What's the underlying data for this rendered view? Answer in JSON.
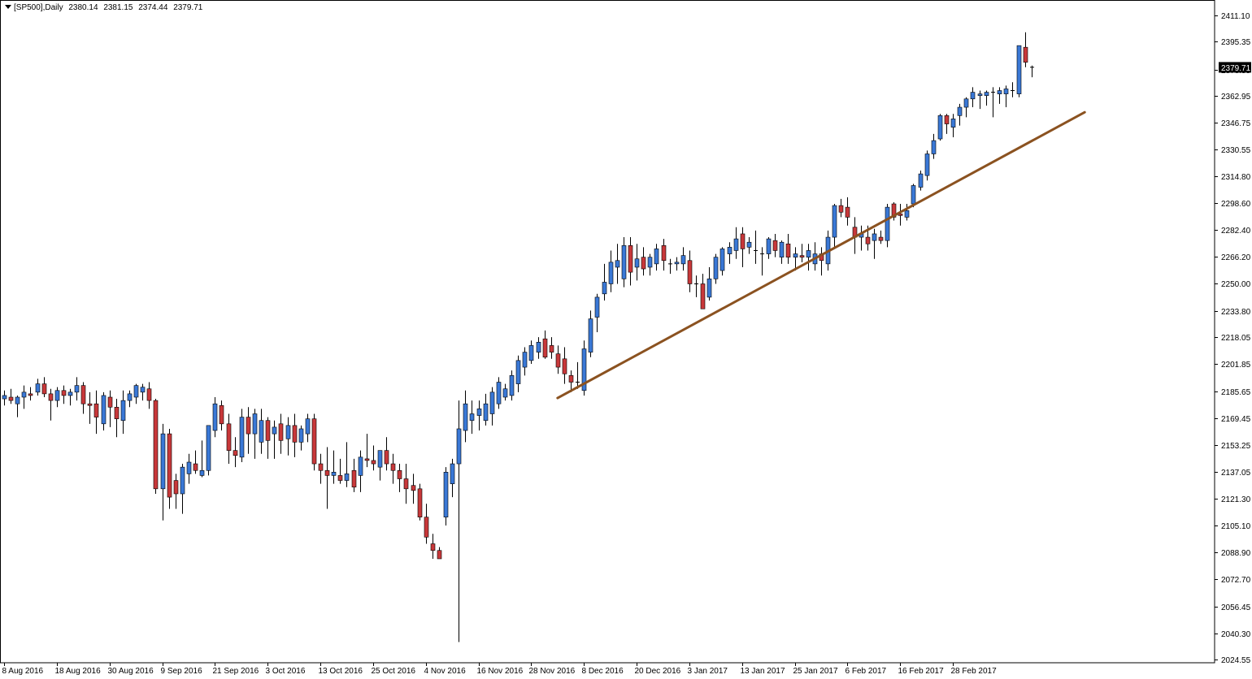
{
  "header": {
    "symbol": "[SP500],Daily",
    "open": "2380.14",
    "high": "2381.15",
    "low": "2374.44",
    "close": "2379.71"
  },
  "colors": {
    "bull": "#3a78d6",
    "bear": "#c8383a",
    "wick": "#000000",
    "trendline": "#8b5220",
    "axis": "#000000",
    "background": "#ffffff",
    "price_label_bg": "#000000",
    "price_label_fg": "#ffffff"
  },
  "chart_data": {
    "type": "candlestick",
    "ylim": [
      2024.55,
      2411.1
    ],
    "y_ticks": [
      "2411.10",
      "2395.35",
      "2378.55",
      "2362.95",
      "2346.75",
      "2330.55",
      "2314.80",
      "2298.60",
      "2282.40",
      "2266.20",
      "2250.00",
      "2233.80",
      "2218.05",
      "2201.85",
      "2185.65",
      "2169.45",
      "2153.25",
      "2137.05",
      "2121.30",
      "2105.10",
      "2088.90",
      "2072.70",
      "2056.45",
      "2040.30",
      "2024.55"
    ],
    "x_labels": [
      {
        "i": 0,
        "label": "8 Aug 2016"
      },
      {
        "i": 8,
        "label": "18 Aug 2016"
      },
      {
        "i": 16,
        "label": "30 Aug 2016"
      },
      {
        "i": 24,
        "label": "9 Sep 2016"
      },
      {
        "i": 32,
        "label": "21 Sep 2016"
      },
      {
        "i": 40,
        "label": "3 Oct 2016"
      },
      {
        "i": 48,
        "label": "13 Oct 2016"
      },
      {
        "i": 56,
        "label": "25 Oct 2016"
      },
      {
        "i": 64,
        "label": "4 Nov 2016"
      },
      {
        "i": 72,
        "label": "16 Nov 2016"
      },
      {
        "i": 80,
        "label": "28 Nov 2016"
      },
      {
        "i": 88,
        "label": "8 Dec 2016"
      },
      {
        "i": 96,
        "label": "20 Dec 2016"
      },
      {
        "i": 104,
        "label": "3 Jan 2017"
      },
      {
        "i": 112,
        "label": "13 Jan 2017"
      },
      {
        "i": 120,
        "label": "25 Jan 2017"
      },
      {
        "i": 128,
        "label": "6 Feb 2017"
      },
      {
        "i": 136,
        "label": "16 Feb 2017"
      },
      {
        "i": 144,
        "label": "28 Feb 2017"
      }
    ],
    "current_price_label": "2379.71",
    "current_price": 2379.71,
    "trendline": {
      "from": {
        "i": 84,
        "price": 2181.5
      },
      "to": {
        "i": 164,
        "price": 2353.0
      }
    },
    "candles": [
      [
        2181,
        2186,
        2177,
        2183
      ],
      [
        2182,
        2187,
        2178,
        2180
      ],
      [
        2178,
        2183,
        2170,
        2182
      ],
      [
        2182,
        2189,
        2175,
        2185
      ],
      [
        2184,
        2188,
        2180,
        2183
      ],
      [
        2185,
        2193,
        2183,
        2190
      ],
      [
        2190,
        2194,
        2182,
        2184
      ],
      [
        2184,
        2187,
        2168,
        2180
      ],
      [
        2180,
        2188,
        2176,
        2186
      ],
      [
        2186,
        2189,
        2178,
        2183
      ],
      [
        2183,
        2187,
        2177,
        2185
      ],
      [
        2185,
        2194,
        2180,
        2189
      ],
      [
        2189,
        2191,
        2172,
        2178
      ],
      [
        2178,
        2185,
        2166,
        2177
      ],
      [
        2178,
        2186,
        2160,
        2170
      ],
      [
        2166,
        2185,
        2162,
        2183
      ],
      [
        2182,
        2186,
        2164,
        2176
      ],
      [
        2176,
        2181,
        2158,
        2169
      ],
      [
        2168,
        2186,
        2160,
        2180
      ],
      [
        2180,
        2186,
        2176,
        2184
      ],
      [
        2182,
        2190,
        2178,
        2189
      ],
      [
        2185,
        2190,
        2180,
        2188
      ],
      [
        2187,
        2191,
        2175,
        2180
      ],
      [
        2180,
        2181,
        2124,
        2127
      ],
      [
        2127,
        2166,
        2108,
        2160
      ],
      [
        2160,
        2163,
        2115,
        2122
      ],
      [
        2132,
        2136,
        2115,
        2124
      ],
      [
        2124,
        2142,
        2112,
        2140
      ],
      [
        2136,
        2148,
        2130,
        2143
      ],
      [
        2142,
        2150,
        2136,
        2138
      ],
      [
        2135,
        2156,
        2134,
        2138
      ],
      [
        2138,
        2165,
        2135,
        2165
      ],
      [
        2162,
        2182,
        2158,
        2178
      ],
      [
        2177,
        2180,
        2162,
        2166
      ],
      [
        2166,
        2172,
        2142,
        2150
      ],
      [
        2150,
        2158,
        2140,
        2147
      ],
      [
        2146,
        2175,
        2143,
        2170
      ],
      [
        2170,
        2176,
        2148,
        2160
      ],
      [
        2160,
        2175,
        2145,
        2172
      ],
      [
        2155,
        2175,
        2148,
        2168
      ],
      [
        2168,
        2170,
        2145,
        2156
      ],
      [
        2160,
        2168,
        2145,
        2164
      ],
      [
        2166,
        2172,
        2148,
        2156
      ],
      [
        2157,
        2170,
        2147,
        2165
      ],
      [
        2165,
        2172,
        2146,
        2155
      ],
      [
        2155,
        2165,
        2150,
        2163
      ],
      [
        2160,
        2172,
        2155,
        2169
      ],
      [
        2169,
        2172,
        2138,
        2142
      ],
      [
        2142,
        2148,
        2130,
        2138
      ],
      [
        2138,
        2152,
        2115,
        2135
      ],
      [
        2135,
        2150,
        2130,
        2137
      ],
      [
        2135,
        2145,
        2130,
        2132
      ],
      [
        2132,
        2155,
        2128,
        2136
      ],
      [
        2138,
        2145,
        2125,
        2128
      ],
      [
        2135,
        2150,
        2125,
        2146
      ],
      [
        2145,
        2160,
        2140,
        2144
      ],
      [
        2144,
        2153,
        2138,
        2142
      ],
      [
        2140,
        2150,
        2132,
        2150
      ],
      [
        2150,
        2158,
        2138,
        2142
      ],
      [
        2142,
        2148,
        2130,
        2138
      ],
      [
        2138,
        2142,
        2125,
        2133
      ],
      [
        2133,
        2142,
        2118,
        2127
      ],
      [
        2129,
        2136,
        2118,
        2126
      ],
      [
        2127,
        2130,
        2108,
        2110
      ],
      [
        2110,
        2118,
        2094,
        2098
      ],
      [
        2094,
        2100,
        2085,
        2090
      ],
      [
        2090,
        2092,
        2085,
        2085
      ],
      [
        2110,
        2140,
        2105,
        2137
      ],
      [
        2130,
        2145,
        2122,
        2142
      ],
      [
        2142,
        2180,
        2035,
        2163
      ],
      [
        2162,
        2186,
        2155,
        2178
      ],
      [
        2168,
        2180,
        2160,
        2172
      ],
      [
        2171,
        2180,
        2162,
        2175
      ],
      [
        2168,
        2184,
        2165,
        2178
      ],
      [
        2172,
        2188,
        2165,
        2185
      ],
      [
        2178,
        2194,
        2175,
        2191
      ],
      [
        2182,
        2190,
        2180,
        2187
      ],
      [
        2183,
        2198,
        2180,
        2195
      ],
      [
        2190,
        2207,
        2185,
        2204
      ],
      [
        2200,
        2212,
        2195,
        2209
      ],
      [
        2204,
        2216,
        2202,
        2213
      ],
      [
        2209,
        2218,
        2205,
        2215
      ],
      [
        2217,
        2222,
        2205,
        2206
      ],
      [
        2213,
        2218,
        2205,
        2209
      ],
      [
        2208,
        2213,
        2196,
        2200
      ],
      [
        2205,
        2212,
        2190,
        2196
      ],
      [
        2195,
        2198,
        2185,
        2191
      ],
      [
        2191,
        2203,
        2187,
        2191
      ],
      [
        2186,
        2216,
        2183,
        2211
      ],
      [
        2209,
        2234,
        2206,
        2229
      ],
      [
        2230,
        2244,
        2221,
        2242
      ],
      [
        2244,
        2262,
        2240,
        2251
      ],
      [
        2250,
        2270,
        2245,
        2263
      ],
      [
        2260,
        2274,
        2250,
        2264
      ],
      [
        2253,
        2278,
        2248,
        2273
      ],
      [
        2273,
        2278,
        2249,
        2257
      ],
      [
        2260,
        2274,
        2252,
        2265
      ],
      [
        2266,
        2272,
        2255,
        2259
      ],
      [
        2260,
        2268,
        2255,
        2266
      ],
      [
        2262,
        2274,
        2258,
        2271
      ],
      [
        2273,
        2277,
        2258,
        2264
      ],
      [
        2262,
        2265,
        2256,
        2262
      ],
      [
        2262,
        2266,
        2258,
        2263
      ],
      [
        2262,
        2272,
        2258,
        2267
      ],
      [
        2264,
        2270,
        2245,
        2250
      ],
      [
        2250,
        2255,
        2242,
        2250
      ],
      [
        2250,
        2256,
        2235,
        2235
      ],
      [
        2242,
        2260,
        2240,
        2253
      ],
      [
        2253,
        2268,
        2250,
        2266
      ],
      [
        2258,
        2272,
        2255,
        2271
      ],
      [
        2268,
        2275,
        2262,
        2272
      ],
      [
        2270,
        2284,
        2265,
        2277
      ],
      [
        2280,
        2284,
        2260,
        2271
      ],
      [
        2272,
        2278,
        2268,
        2275
      ],
      [
        2270,
        2282,
        2262,
        2270
      ],
      [
        2268,
        2272,
        2255,
        2268
      ],
      [
        2268,
        2278,
        2265,
        2277
      ],
      [
        2276,
        2280,
        2266,
        2270
      ],
      [
        2266,
        2276,
        2262,
        2275
      ],
      [
        2274,
        2280,
        2262,
        2266
      ],
      [
        2266,
        2272,
        2258,
        2268
      ],
      [
        2267,
        2274,
        2263,
        2266
      ],
      [
        2266,
        2274,
        2258,
        2270
      ],
      [
        2262,
        2275,
        2258,
        2268
      ],
      [
        2268,
        2272,
        2255,
        2264
      ],
      [
        2262,
        2282,
        2258,
        2278
      ],
      [
        2278,
        2298,
        2272,
        2297
      ],
      [
        2297,
        2301,
        2290,
        2293
      ],
      [
        2296,
        2302,
        2285,
        2290
      ],
      [
        2284,
        2290,
        2268,
        2278
      ],
      [
        2278,
        2285,
        2270,
        2280
      ],
      [
        2278,
        2285,
        2270,
        2274
      ],
      [
        2276,
        2283,
        2265,
        2280
      ],
      [
        2278,
        2282,
        2274,
        2276
      ],
      [
        2276,
        2298,
        2272,
        2296
      ],
      [
        2298,
        2299,
        2288,
        2290
      ],
      [
        2292,
        2298,
        2285,
        2291
      ],
      [
        2290,
        2298,
        2288,
        2294
      ],
      [
        2298,
        2310,
        2296,
        2309
      ],
      [
        2308,
        2318,
        2306,
        2316
      ],
      [
        2315,
        2330,
        2312,
        2328
      ],
      [
        2328,
        2340,
        2325,
        2336
      ],
      [
        2337,
        2352,
        2336,
        2351
      ],
      [
        2351,
        2352,
        2340,
        2346
      ],
      [
        2344,
        2352,
        2338,
        2349
      ],
      [
        2351,
        2358,
        2345,
        2356
      ],
      [
        2356,
        2362,
        2350,
        2361
      ],
      [
        2361,
        2368,
        2356,
        2365
      ],
      [
        2363,
        2366,
        2355,
        2364
      ],
      [
        2363,
        2366,
        2357,
        2365
      ],
      [
        2365,
        2368,
        2350,
        2365
      ],
      [
        2364,
        2368,
        2358,
        2366
      ],
      [
        2364,
        2369,
        2356,
        2367
      ],
      [
        2366,
        2371,
        2362,
        2366
      ],
      [
        2364,
        2393,
        2362,
        2393
      ],
      [
        2392,
        2401,
        2380,
        2383
      ],
      [
        2380,
        2381,
        2374,
        2380
      ]
    ]
  }
}
